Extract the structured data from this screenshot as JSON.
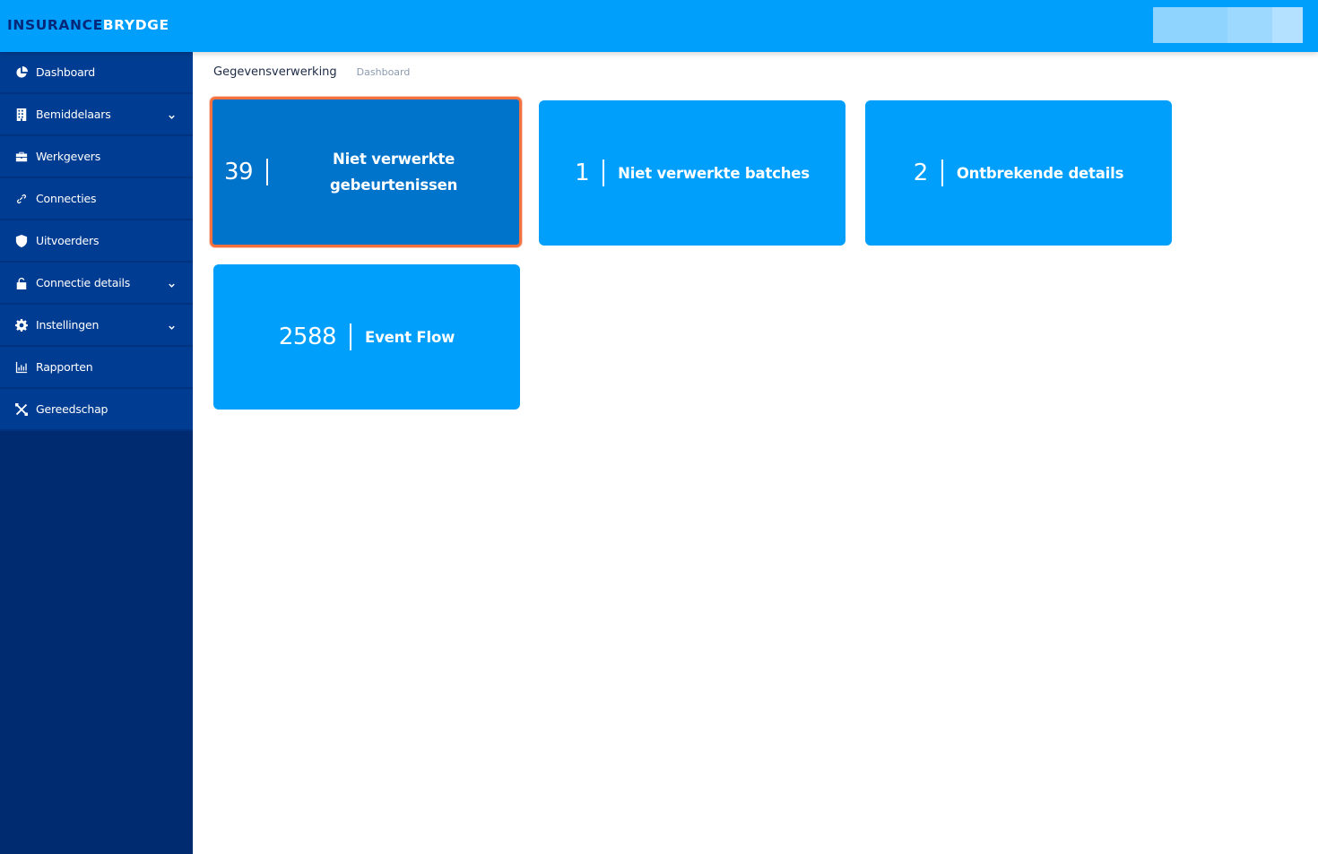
{
  "logo": {
    "part1": "INSURANCE",
    "part2": "BRYDGE"
  },
  "sidebar": {
    "items": [
      {
        "label": "Dashboard",
        "icon": "pie-chart-icon",
        "has_submenu": false
      },
      {
        "label": "Bemiddelaars",
        "icon": "building-icon",
        "has_submenu": true
      },
      {
        "label": "Werkgevers",
        "icon": "briefcase-icon",
        "has_submenu": false
      },
      {
        "label": "Connecties",
        "icon": "link-icon",
        "has_submenu": false
      },
      {
        "label": "Uitvoerders",
        "icon": "shield-icon",
        "has_submenu": false
      },
      {
        "label": "Connectie details",
        "icon": "lock-icon",
        "has_submenu": true
      },
      {
        "label": "Instellingen",
        "icon": "gear-icon",
        "has_submenu": true
      },
      {
        "label": "Rapporten",
        "icon": "bar-chart-icon",
        "has_submenu": false
      },
      {
        "label": "Gereedschap",
        "icon": "tools-icon",
        "has_submenu": false
      }
    ]
  },
  "breadcrumb": {
    "title": "Gegevensverwerking",
    "current": "Dashboard"
  },
  "cards": [
    {
      "number": "39",
      "label": "Niet verwerkte gebeurtenissen",
      "selected": true
    },
    {
      "number": "1",
      "label": "Niet verwerkte batches",
      "selected": false
    },
    {
      "number": "2",
      "label": "Ontbrekende details",
      "selected": false
    },
    {
      "number": "2588",
      "label": "Event Flow",
      "selected": false
    }
  ],
  "colors": {
    "topbar": "#009ffc",
    "sidebar": "#002b71",
    "sidebar_item": "#003c91",
    "card": "#009ffc",
    "card_selected": "#0073cb",
    "selection_border": "#f2713f"
  }
}
